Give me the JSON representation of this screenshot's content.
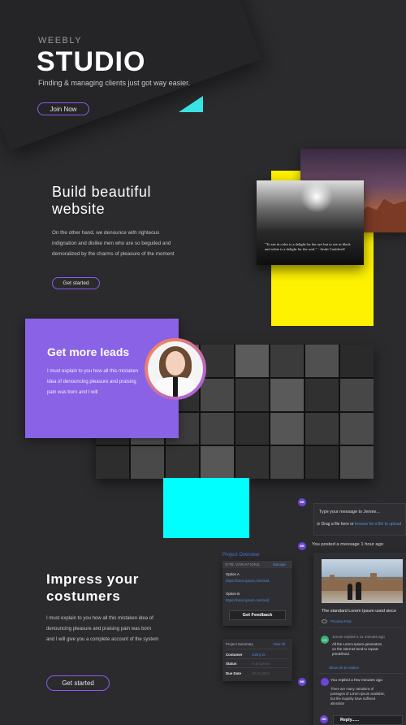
{
  "hero": {
    "brand": "WEEBLY",
    "title": "STUDIO",
    "tagline": "Finding & managing clients just got way easier.",
    "cta": "Join Now"
  },
  "build": {
    "title": "Build beautiful website",
    "body": "On the other hand, we denounce with righteous indignation and dislike men who are so beguiled and demoralized by the charms of pleasure of the moment",
    "cta": "Get started",
    "quote": "\"To see in color is a delight for the eye but to see in black and white is a delight for the soul.\" - Andri Cauldwell"
  },
  "leads": {
    "title": "Get more leads",
    "body": "I must explain to you how all this mistaken idea of denouncing pleasure and praising pain was born and I will"
  },
  "impress": {
    "title": "Impress your costumers",
    "body": "I must explain to you how all this mistaken idea of denouncing pleasure and praising pain was born and I will give you a complete account of the system",
    "cta": "Get started"
  },
  "project_overview": {
    "label": "Project Overview",
    "site_variations": "SITE VARIATIONS",
    "manage": "Manage",
    "option_a": "Option A",
    "option_a_url": "https://lorem.ipsum.com/ovid",
    "option_b": "Option B",
    "option_b_url": "https://lorem.ipsum.com/ovid",
    "feedback": "Get Feedback"
  },
  "project_summary": {
    "title": "Project Summary",
    "view_all": "View All",
    "customer_key": "Costumer",
    "customer_val": "Johny D.",
    "status_key": "Status",
    "status_val": "In progress",
    "due_key": "Due Date",
    "due_val": "10.10.2016"
  },
  "messages": {
    "badge": "BB",
    "placeholder": "Type your message to Jennie...",
    "drag_text": "Drag a file here or",
    "drag_link": "browse for a file to upload",
    "posted": "You posted a message 1 hour ago",
    "caption": "The standard Lorem Ipsum used since",
    "preview": "Preview Post",
    "reply_head": "Jennie replied a 11 minutes ago",
    "reply_avatar": "KD",
    "reply_body": "All the Lorem Ipsum generators on the Internet tend to repeat predefined.",
    "show_all": "Show all 10 replies",
    "reply2_head": "You replied a few minutes ago",
    "reply2_body": "There are many variations of passages of Lorem Ipsum available, but the majority have suffered alteration",
    "reply_input": "Reply......"
  }
}
